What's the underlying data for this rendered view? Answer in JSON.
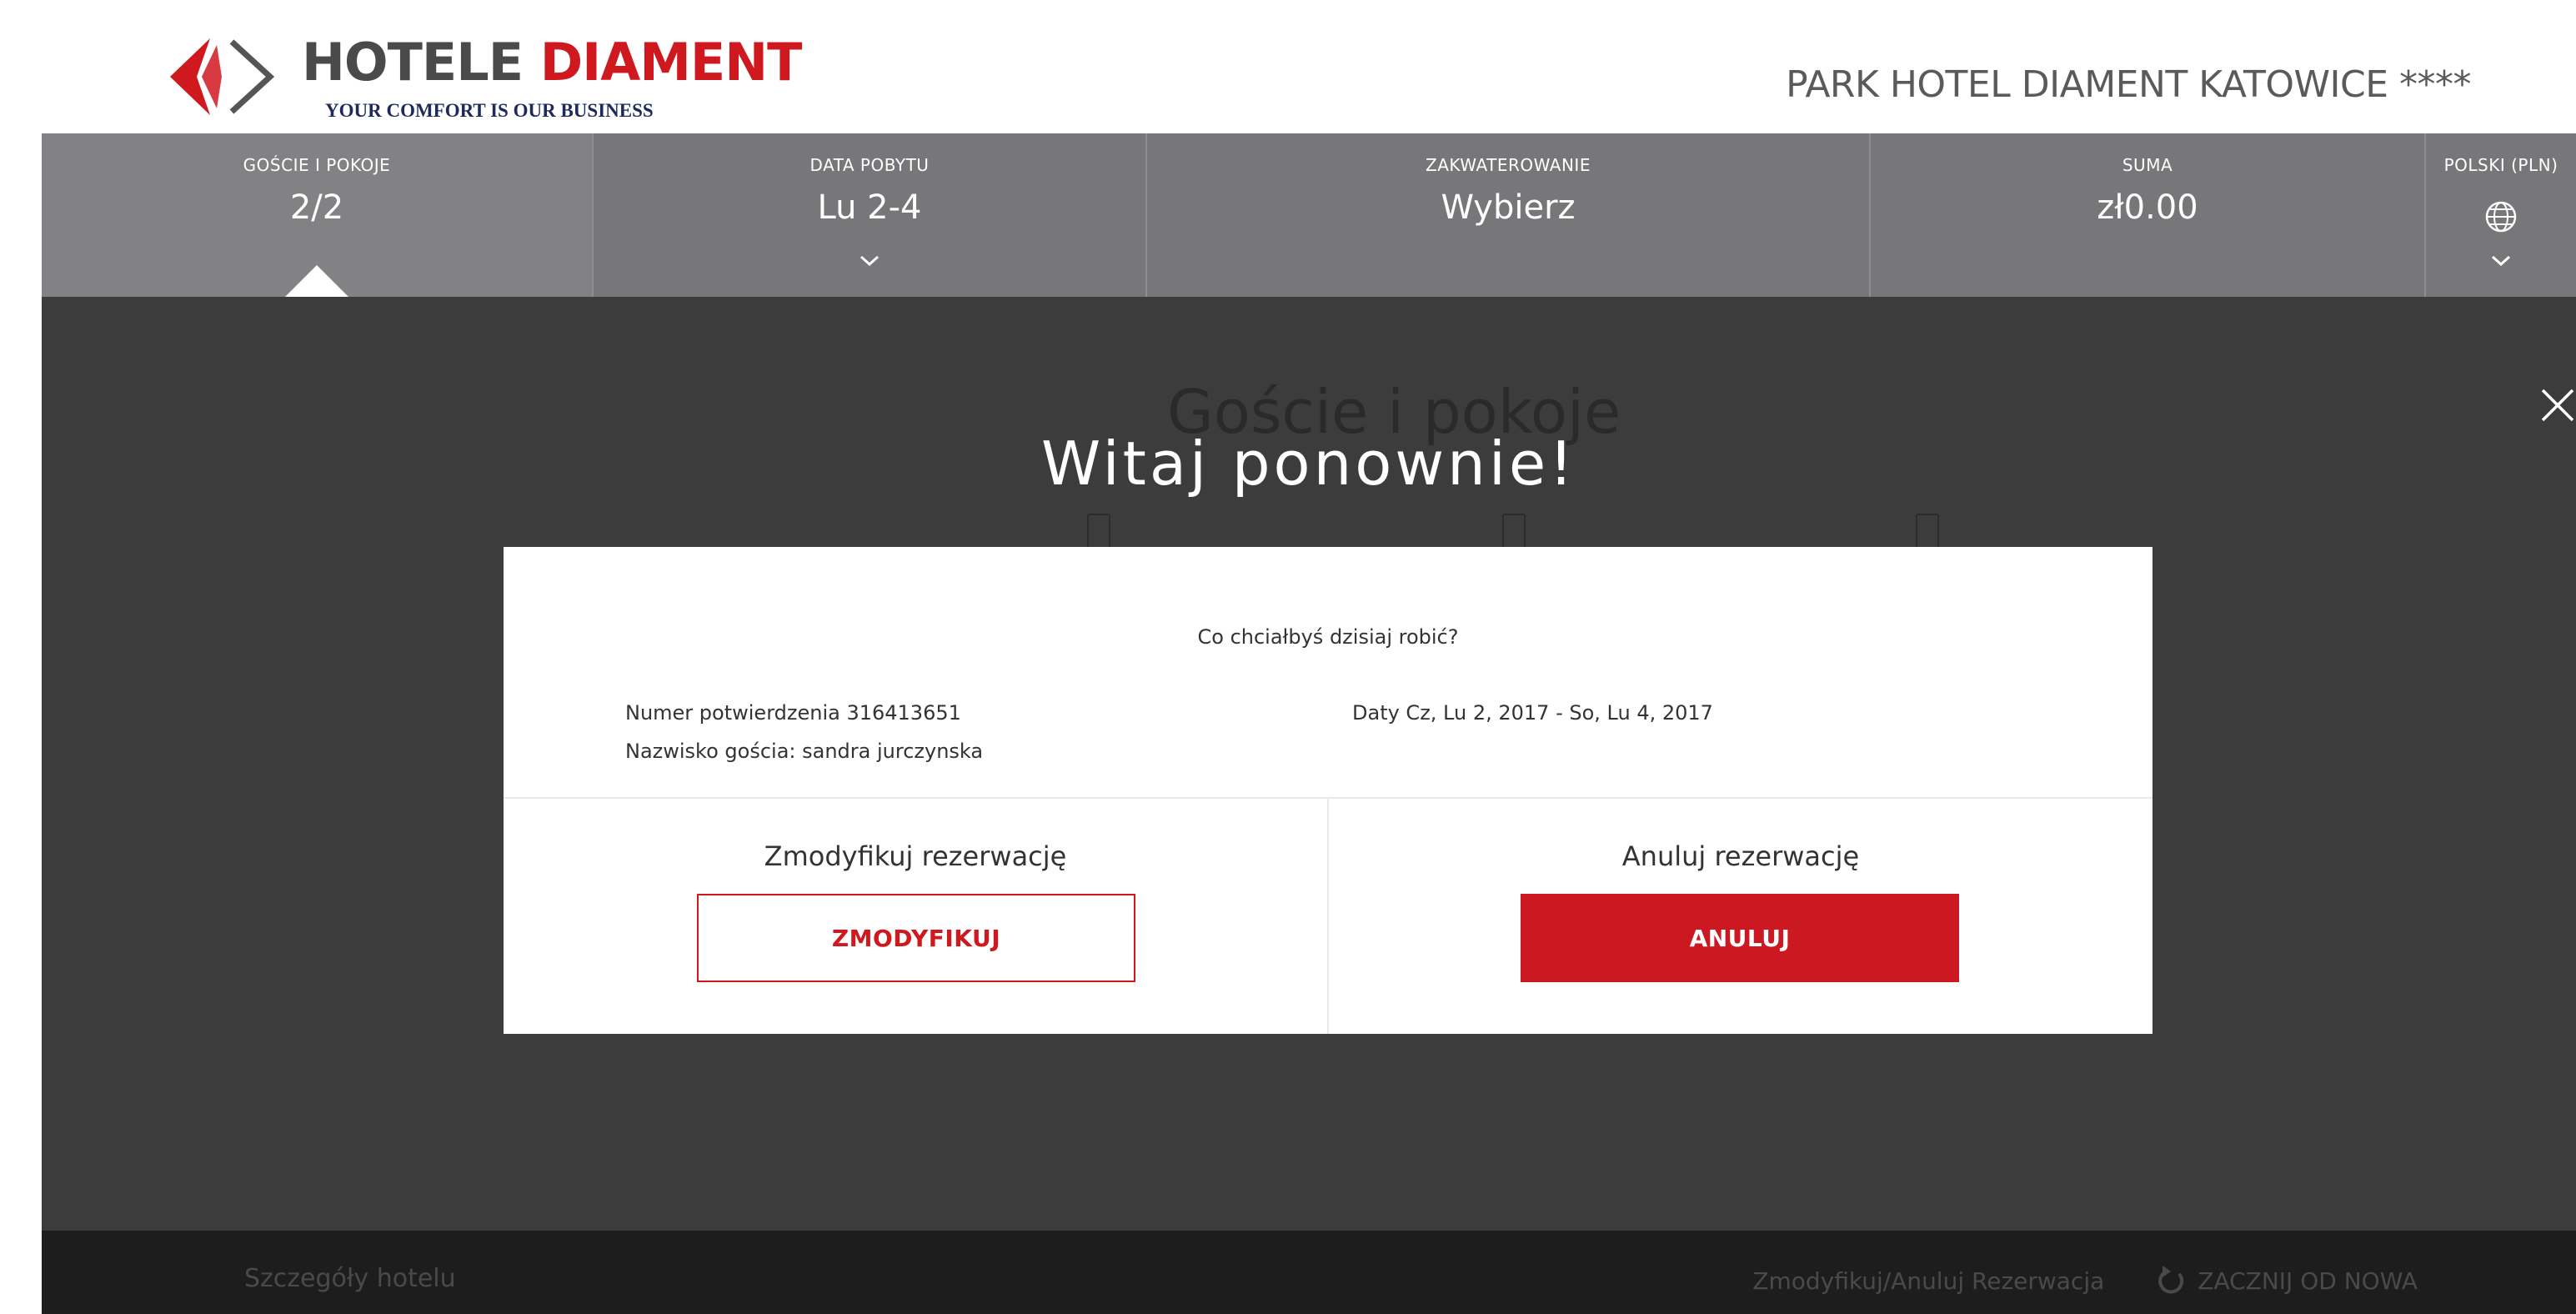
{
  "brand": {
    "name_part1": "HOTELE",
    "name_part2": "DIAMENT",
    "tagline": "YOUR COMFORT IS OUR BUSINESS",
    "accent_color": "#d0181f"
  },
  "hotel": {
    "name": "PARK HOTEL DIAMENT KATOWICE ****"
  },
  "nav": {
    "guests": {
      "label": "GOŚCIE I POKOJE",
      "value": "2/2"
    },
    "dates": {
      "label": "DATA POBYTU",
      "value": "Lu 2-4"
    },
    "accommodation": {
      "label": "ZAKWATEROWANIE",
      "value": "Wybierz"
    },
    "total": {
      "label": "SUMA",
      "value": "zł0.00"
    },
    "language": {
      "label": "POLSKI (PLN)",
      "icon": "globe-icon"
    }
  },
  "background": {
    "title": "Goście i pokoje"
  },
  "welcome": {
    "title": "Witaj ponownie!"
  },
  "modal": {
    "question": "Co chciałbyś dzisiaj robić?",
    "confirmation": "Numer potwierdzenia 316413651",
    "guest_name": "Nazwisko gościa: sandra jurczynska",
    "dates": "Daty Cz, Lu 2, 2017 - So, Lu 4, 2017",
    "modify_title": "Zmodyfikuj rezerwację",
    "modify_button": "ZMODYFIKUJ",
    "cancel_title": "Anuluj rezerwację",
    "cancel_button": "ANULUJ"
  },
  "footer": {
    "hotel_details": "Szczegóły hotelu",
    "modify_cancel_link": "Zmodyfikuj/Anuluj Rezerwacja",
    "restart": "ZACZNIJ OD NOWA"
  }
}
